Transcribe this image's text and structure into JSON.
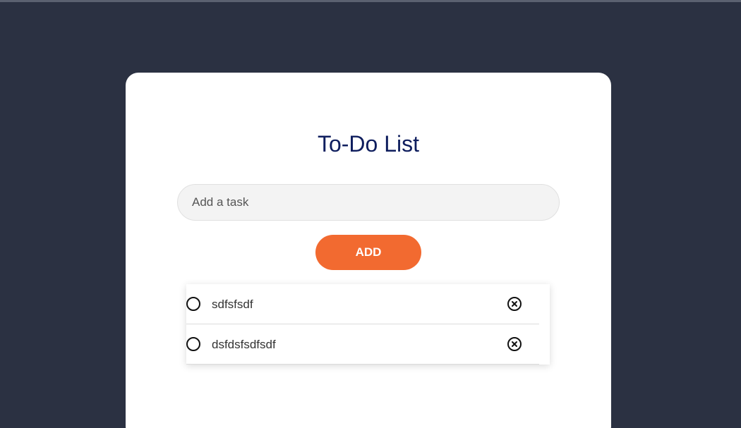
{
  "app": {
    "title": "To-Do List"
  },
  "input": {
    "placeholder": "Add a task",
    "value": ""
  },
  "add_button": {
    "label": "ADD"
  },
  "tasks": [
    {
      "text": "sdfsfsdf",
      "completed": false
    },
    {
      "text": "dsfdsfsdfsdf",
      "completed": false
    }
  ],
  "colors": {
    "background": "#2b3142",
    "card": "#ffffff",
    "title": "#0f1e5e",
    "accent": "#f26a30"
  },
  "icons": {
    "check": "circle-outline-icon",
    "remove": "close-circle-icon"
  }
}
